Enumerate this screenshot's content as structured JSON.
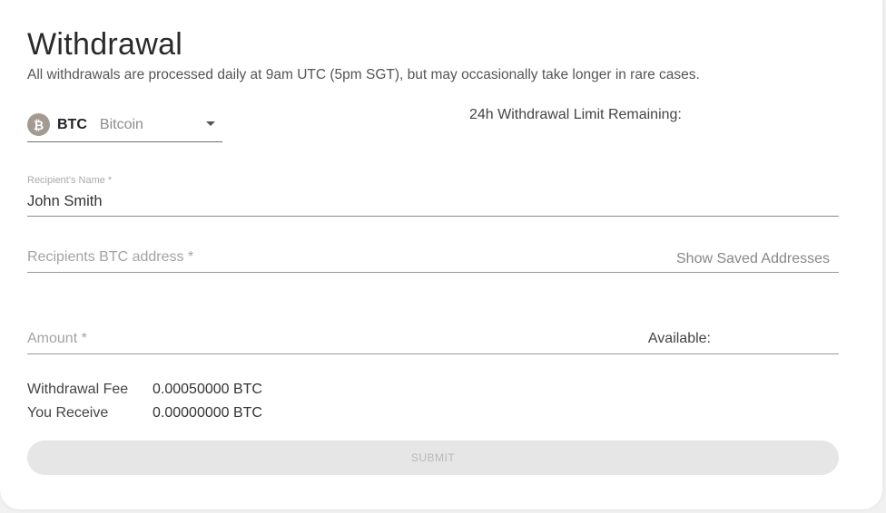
{
  "header": {
    "title": "Withdrawal",
    "subtitle": "All withdrawals are processed daily at 9am UTC (5pm SGT), but may occasionally take longer in rare cases."
  },
  "currency": {
    "icon_glyph": "₿",
    "icon_name": "bitcoin-icon",
    "icon_color": "#a39a92",
    "symbol": "BTC",
    "name": "Bitcoin"
  },
  "limit_label": "24h Withdrawal Limit Remaining:",
  "form": {
    "recipient_name": {
      "label": "Recipient's Name *",
      "value": "John Smith"
    },
    "address": {
      "placeholder": "Recipients BTC address *",
      "show_saved": "Show Saved Addresses"
    },
    "amount": {
      "placeholder": "Amount *",
      "available_label": "Available:"
    }
  },
  "summary": {
    "fee_label": "Withdrawal Fee",
    "fee_value": "0.00050000 BTC",
    "receive_label": "You Receive",
    "receive_value": "0.00000000 BTC"
  },
  "submit_label": "SUBMIT"
}
